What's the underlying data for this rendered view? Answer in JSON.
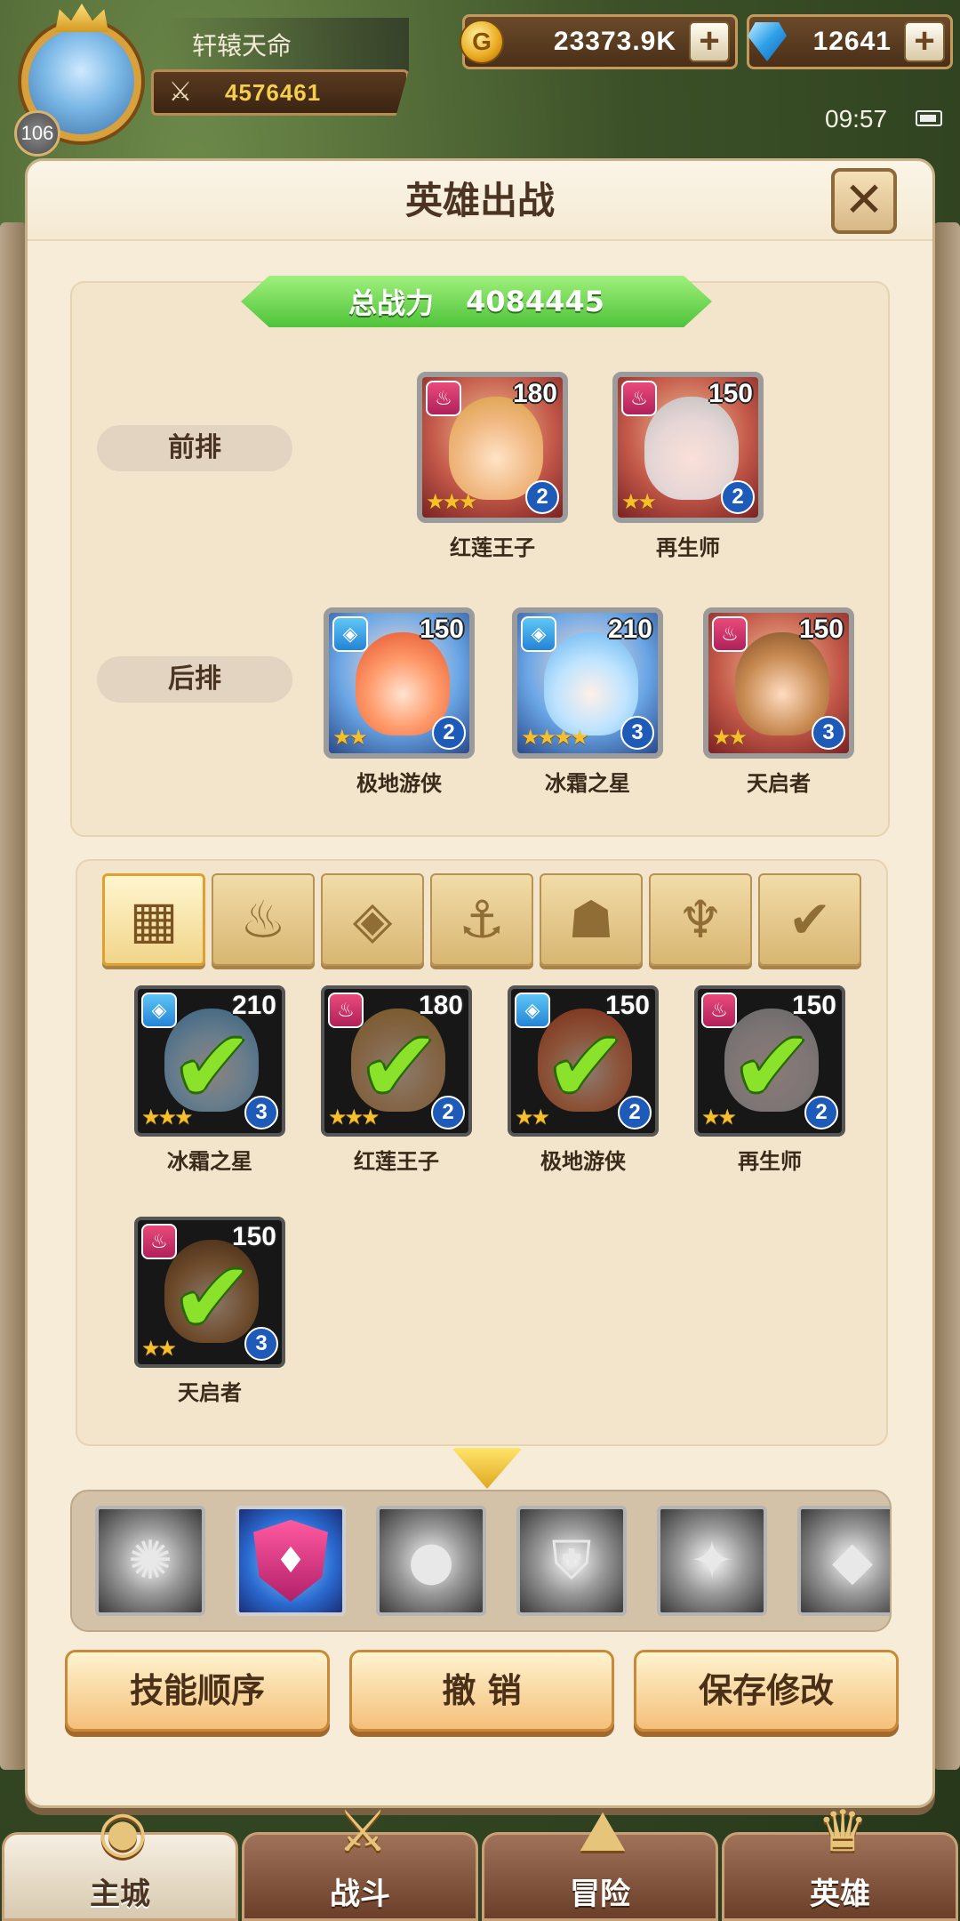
{
  "player": {
    "name": "轩辕天命",
    "level": "106",
    "power": "4576461"
  },
  "resources": {
    "gold": "23373.9K",
    "gems": "12641"
  },
  "status": {
    "time": "09:57"
  },
  "panel": {
    "title": "英雄出战",
    "total_power_label": "总战力",
    "total_power_value": "4084445"
  },
  "lineup": {
    "front_label": "前排",
    "back_label": "后排",
    "front": [
      {
        "name": "红莲王子",
        "level": "180",
        "stars": "★★★",
        "grade": "2",
        "faction": "fire"
      },
      {
        "name": "再生师",
        "level": "150",
        "stars": "★★",
        "grade": "2",
        "faction": "fire"
      }
    ],
    "back": [
      {
        "name": "极地游侠",
        "level": "150",
        "stars": "★★",
        "grade": "2",
        "faction": "water"
      },
      {
        "name": "冰霜之星",
        "level": "210",
        "stars": "★★★★",
        "grade": "3",
        "faction": "water"
      },
      {
        "name": "天启者",
        "level": "150",
        "stars": "★★",
        "grade": "3",
        "faction": "fire"
      }
    ]
  },
  "filters": [
    {
      "icon": "grid-icon",
      "glyph": "▦",
      "active": true
    },
    {
      "icon": "fire-faction-icon",
      "glyph": "♨"
    },
    {
      "icon": "water-faction-icon",
      "glyph": "◈"
    },
    {
      "icon": "anchor-icon",
      "glyph": "⚓"
    },
    {
      "icon": "beast-icon",
      "glyph": "☗"
    },
    {
      "icon": "dark-faction-icon",
      "glyph": "♆"
    },
    {
      "icon": "light-faction-icon",
      "glyph": "✔"
    }
  ],
  "roster": [
    {
      "name": "冰霜之星",
      "level": "210",
      "stars": "★★★",
      "grade": "3",
      "faction": "water",
      "selected": true
    },
    {
      "name": "红莲王子",
      "level": "180",
      "stars": "★★★",
      "grade": "2",
      "faction": "fire",
      "selected": true
    },
    {
      "name": "极地游侠",
      "level": "150",
      "stars": "★★",
      "grade": "2",
      "faction": "water",
      "selected": true
    },
    {
      "name": "再生师",
      "level": "150",
      "stars": "★★",
      "grade": "2",
      "faction": "fire",
      "selected": true
    },
    {
      "name": "天启者",
      "level": "150",
      "stars": "★★",
      "grade": "3",
      "faction": "fire",
      "selected": true
    }
  ],
  "skills": [
    "vortex-skill-icon",
    "shield-skill-icon",
    "orb-skill-icon",
    "guard-skill-icon",
    "slash-skill-icon",
    "crystal-skill-icon"
  ],
  "buttons": {
    "skill_order": "技能顺序",
    "undo": "撤 销",
    "save": "保存修改"
  },
  "nav": {
    "main_city": "主城",
    "battle": "战斗",
    "adventure": "冒险",
    "heroes": "英雄"
  }
}
